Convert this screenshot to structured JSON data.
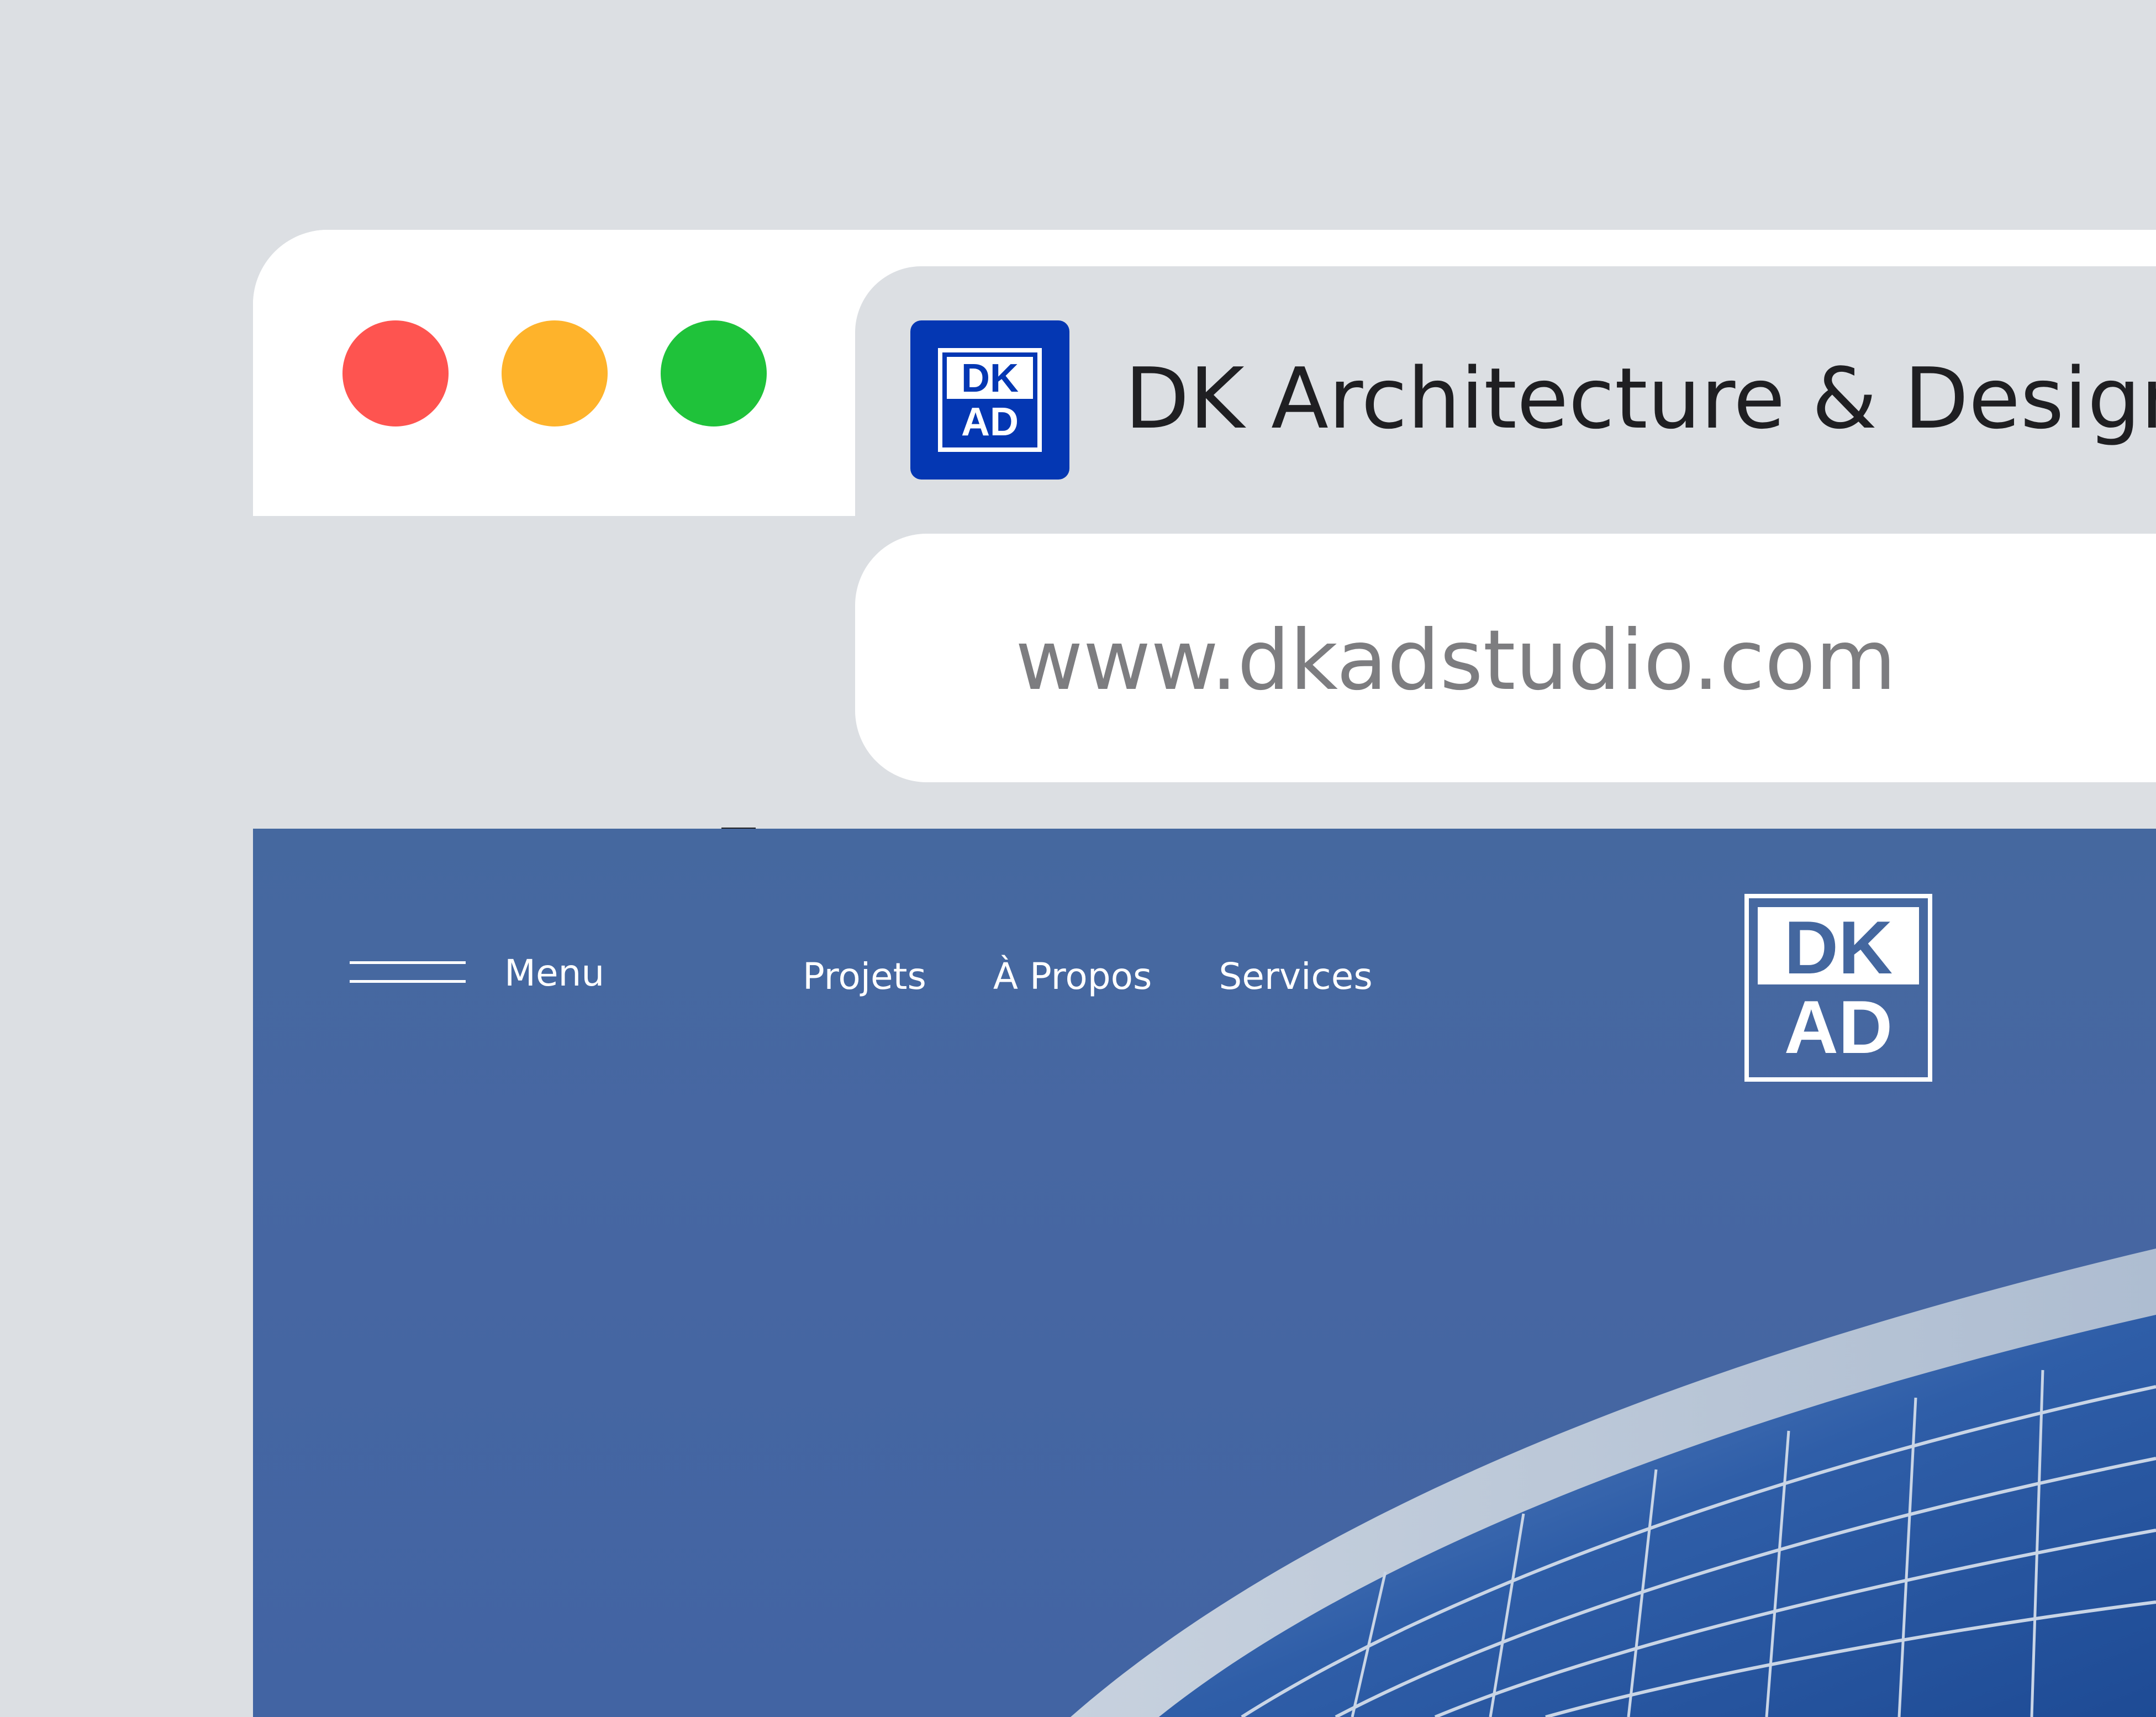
{
  "browser": {
    "window_controls": {
      "close_color": "#fe5450",
      "minimize_color": "#feb32b",
      "maximize_color": "#1fc23a"
    },
    "tab": {
      "title": "DK Architecture & Design",
      "favicon": {
        "top_text": "DK",
        "bottom_text": "AD",
        "color": "#0437b3"
      }
    },
    "toolbar": {
      "back_icon": "arrow-left-icon",
      "forward_icon": "arrow-right-icon",
      "reload_icon": "reload-icon"
    },
    "address_bar": {
      "url": "www.dkadstudio.com"
    }
  },
  "website": {
    "menu_label": "Menu",
    "menu_icon": "hamburger-icon",
    "nav": [
      {
        "label": "Projets"
      },
      {
        "label": "À Propos"
      },
      {
        "label": "Services"
      }
    ],
    "logo": {
      "top_text": "DK",
      "bottom_text": "AD"
    },
    "hero_background_color": "#4467a2"
  }
}
